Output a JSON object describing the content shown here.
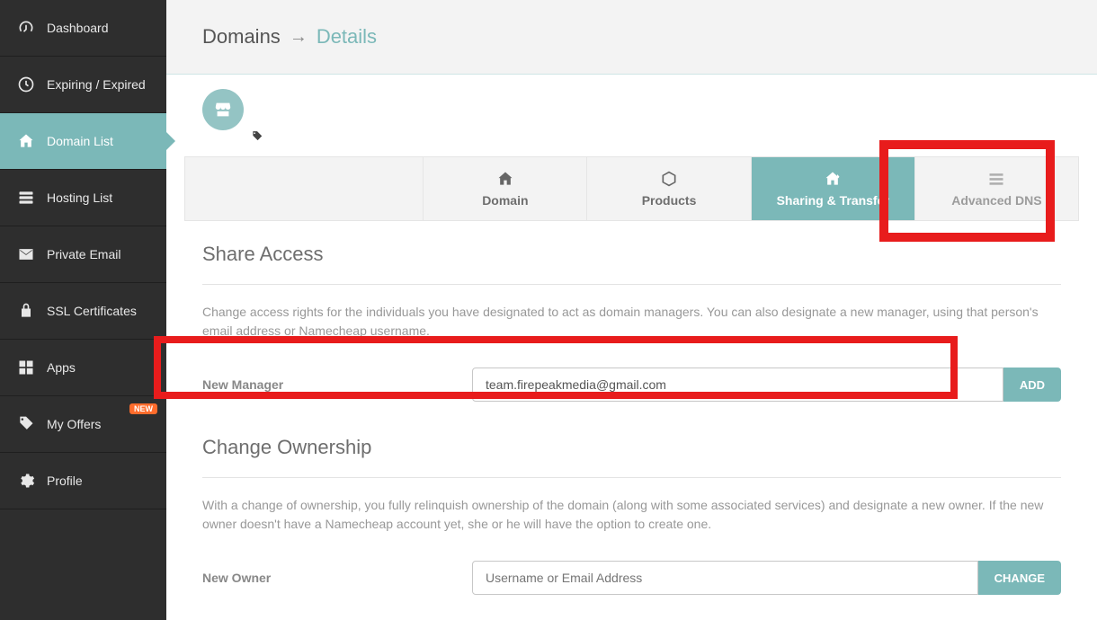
{
  "sidebar": {
    "items": [
      {
        "label": "Dashboard"
      },
      {
        "label": "Expiring / Expired"
      },
      {
        "label": "Domain List"
      },
      {
        "label": "Hosting List"
      },
      {
        "label": "Private Email"
      },
      {
        "label": "SSL Certificates"
      },
      {
        "label": "Apps"
      },
      {
        "label": "My Offers",
        "badge": "NEW"
      },
      {
        "label": "Profile"
      }
    ]
  },
  "breadcrumb": {
    "parent": "Domains",
    "current": "Details"
  },
  "tabs": {
    "domain": "Domain",
    "products": "Products",
    "sharing": "Sharing & Transfer",
    "advanced": "Advanced DNS"
  },
  "share": {
    "title": "Share Access",
    "desc": "Change access rights for the individuals you have designated to act as domain managers. You can also designate a new manager, using that person's email address or Namecheap username.",
    "new_manager_label": "New Manager",
    "new_manager_value": "team.firepeakmedia@gmail.com",
    "add_btn": "ADD"
  },
  "ownership": {
    "title": "Change Ownership",
    "desc": "With a change of ownership, you fully relinquish ownership of the domain (along with some associated services) and designate a new owner. If the new owner doesn't have a Namecheap account yet, she or he will have the option to create one.",
    "new_owner_label": "New Owner",
    "new_owner_placeholder": "Username or Email Address",
    "change_btn": "CHANGE"
  },
  "colors": {
    "accent": "#7bb8b8",
    "highlight": "#e81c1c",
    "sidebar_bg": "#2e2e2e",
    "badge": "#ff6c2c"
  }
}
